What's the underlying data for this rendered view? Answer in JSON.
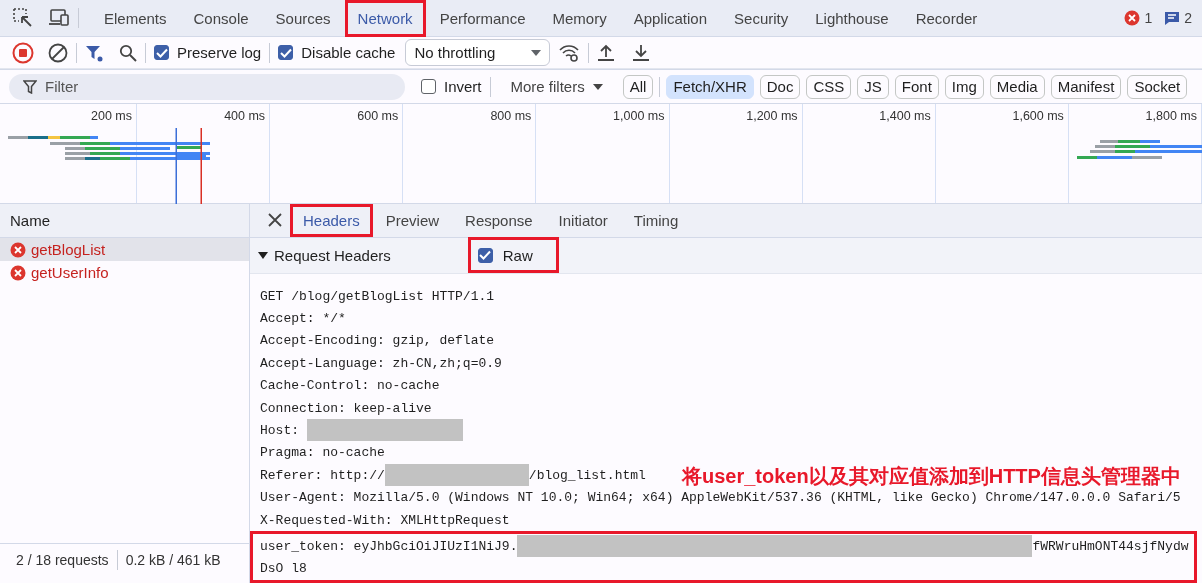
{
  "main_tabs": {
    "items": [
      {
        "label": "Elements",
        "selected": false,
        "highlighted": false
      },
      {
        "label": "Console",
        "selected": false,
        "highlighted": false
      },
      {
        "label": "Sources",
        "selected": false,
        "highlighted": false
      },
      {
        "label": "Network",
        "selected": true,
        "highlighted": true
      },
      {
        "label": "Performance",
        "selected": false,
        "highlighted": false
      },
      {
        "label": "Memory",
        "selected": false,
        "highlighted": false
      },
      {
        "label": "Application",
        "selected": false,
        "highlighted": false
      },
      {
        "label": "Security",
        "selected": false,
        "highlighted": false
      },
      {
        "label": "Lighthouse",
        "selected": false,
        "highlighted": false
      },
      {
        "label": "Recorder",
        "selected": false,
        "highlighted": false
      }
    ],
    "errors_count": "1",
    "issues_count": "2"
  },
  "toolbar": {
    "recording": true,
    "preserve_log": {
      "label": "Preserve log",
      "checked": true
    },
    "disable_cache": {
      "label": "Disable cache",
      "checked": true
    },
    "throttling": "No throttling"
  },
  "filter_bar": {
    "placeholder": "Filter",
    "invert": {
      "label": "Invert",
      "checked": false
    },
    "more_filters": "More filters",
    "types": [
      {
        "label": "All",
        "selected": false
      },
      {
        "label": "Fetch/XHR",
        "selected": true
      },
      {
        "label": "Doc",
        "selected": false
      },
      {
        "label": "CSS",
        "selected": false
      },
      {
        "label": "JS",
        "selected": false
      },
      {
        "label": "Font",
        "selected": false
      },
      {
        "label": "Img",
        "selected": false
      },
      {
        "label": "Media",
        "selected": false
      },
      {
        "label": "Manifest",
        "selected": false
      },
      {
        "label": "Socket",
        "selected": false
      }
    ]
  },
  "overview": {
    "ticks": [
      "200 ms",
      "400 ms",
      "600 ms",
      "800 ms",
      "1,000 ms",
      "1,200 ms",
      "1,400 ms",
      "1,600 ms",
      "1,800 ms"
    ]
  },
  "requests": {
    "column": "Name",
    "rows": [
      {
        "name": "getBlogList",
        "selected": true,
        "failed": true
      },
      {
        "name": "getUserInfo",
        "selected": false,
        "failed": true
      }
    ],
    "status": [
      "2 / 18 requests",
      "0.2 kB / 461 kB"
    ]
  },
  "details": {
    "tabs": [
      {
        "label": "Headers",
        "selected": true,
        "highlighted": true
      },
      {
        "label": "Preview",
        "selected": false,
        "highlighted": false
      },
      {
        "label": "Response",
        "selected": false,
        "highlighted": false
      },
      {
        "label": "Initiator",
        "selected": false,
        "highlighted": false
      },
      {
        "label": "Timing",
        "selected": false,
        "highlighted": false
      }
    ],
    "section": {
      "title": "Request Headers",
      "expanded": true
    },
    "raw": {
      "label": "Raw",
      "checked": true,
      "highlighted": true
    },
    "lines": [
      {
        "highlighted": false,
        "segments": [
          {
            "kind": "text",
            "text": "GET /blog/getBlogList HTTP/1.1"
          }
        ]
      },
      {
        "highlighted": false,
        "segments": [
          {
            "kind": "text",
            "text": "Accept: */*"
          }
        ]
      },
      {
        "highlighted": false,
        "segments": [
          {
            "kind": "text",
            "text": "Accept-Encoding: gzip, deflate"
          }
        ]
      },
      {
        "highlighted": false,
        "segments": [
          {
            "kind": "text",
            "text": "Accept-Language: zh-CN,zh;q=0.9"
          }
        ]
      },
      {
        "highlighted": false,
        "segments": [
          {
            "kind": "text",
            "text": "Cache-Control: no-cache"
          }
        ]
      },
      {
        "highlighted": false,
        "segments": [
          {
            "kind": "text",
            "text": "Connection: keep-alive"
          }
        ]
      },
      {
        "highlighted": false,
        "segments": [
          {
            "kind": "text",
            "text": "Host: "
          },
          {
            "kind": "redacted"
          }
        ]
      },
      {
        "highlighted": false,
        "segments": [
          {
            "kind": "text",
            "text": "Pragma: no-cache"
          }
        ]
      },
      {
        "highlighted": false,
        "segments": [
          {
            "kind": "text",
            "text": "Referer: http://"
          },
          {
            "kind": "redacted"
          },
          {
            "kind": "text",
            "text": "/blog_list.html"
          }
        ]
      },
      {
        "highlighted": false,
        "segments": [
          {
            "kind": "text",
            "text": "User-Agent: Mozilla/5.0 (Windows NT 10.0; Win64; x64) AppleWebKit/537.36 (KHTML, like Gecko) Chrome/147.0.0.0 Safari/5"
          }
        ]
      },
      {
        "highlighted": false,
        "segments": [
          {
            "kind": "text",
            "text": "X-Requested-With: XMLHttpRequest"
          }
        ]
      },
      {
        "highlighted": true,
        "segments": [
          {
            "kind": "text",
            "text": "user_token: eyJhbGciOiJIUzI1NiJ9."
          },
          {
            "kind": "redacted"
          },
          {
            "kind": "text",
            "text": "fWRWruHmONT44sjfNydw"
          }
        ]
      },
      {
        "highlighted": true,
        "segments": [
          {
            "kind": "text",
            "text": "DsO l8"
          }
        ]
      }
    ],
    "annotation": "将user_token以及其对应值添加到HTTP信息头管理器中"
  }
}
